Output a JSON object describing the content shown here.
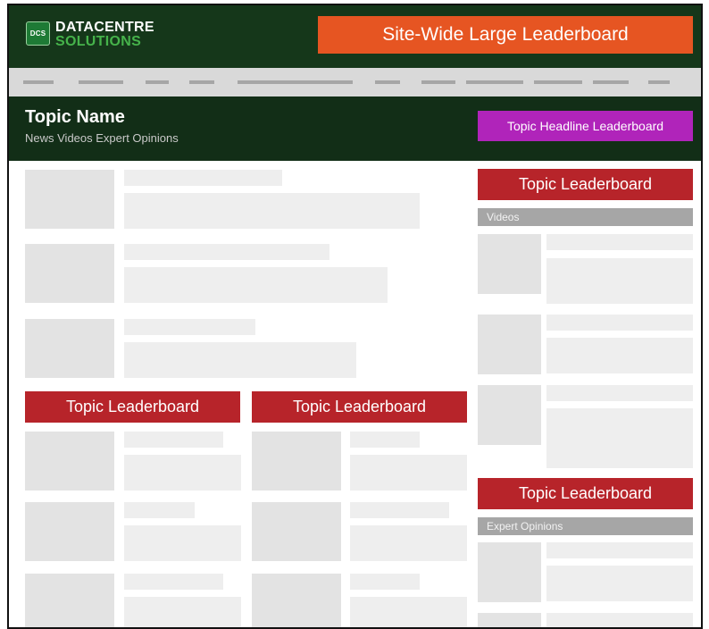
{
  "logo": {
    "badge": "DCS",
    "line1": "DATACENTRE",
    "line2": "SOLUTIONS"
  },
  "ads": {
    "site_wide": "Site-Wide Large Leaderboard",
    "topic_headline": "Topic Headline Leaderboard",
    "topic": "Topic Leaderboard"
  },
  "topic": {
    "name": "Topic Name",
    "links": "News Videos Expert Opinions"
  },
  "sidebar": {
    "videos_label": "Videos",
    "expert_label": "Expert Opinions"
  },
  "colors": {
    "header_bg": "#15371a",
    "topic_bar_bg": "#122e17",
    "site_ad": "#e65522",
    "topic_headline_ad": "#b024ba",
    "topic_ad": "#b7242a",
    "placeholder": "#eeeeee",
    "label_gray": "#a6a6a6"
  }
}
